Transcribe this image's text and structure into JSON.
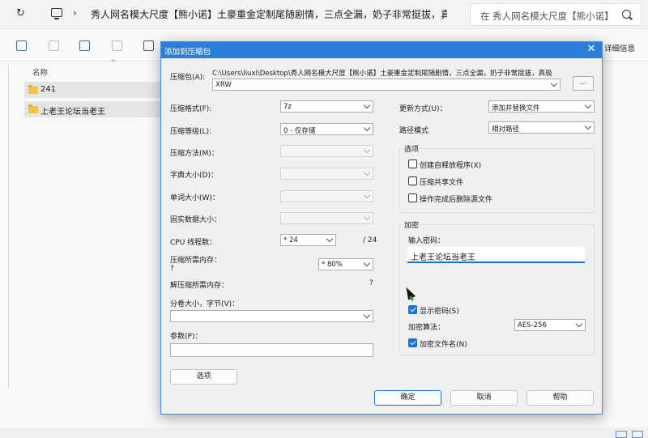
{
  "explorer": {
    "address_text": "秀人网名模大尺度【熊小诺】土豪重金定制尾随剧情，三点全漏，奶子非常挺拔，真极品",
    "search_placeholder": "在 秀人网名模大尺度【熊小诺】",
    "detail_label": "详细信息",
    "column_name": "名称",
    "files": [
      {
        "name": "241",
        "type": "folder-icon"
      },
      {
        "name": "上老王论坛当老王",
        "type": "folder-icon"
      }
    ]
  },
  "dialog": {
    "title": "添加到压缩包",
    "archive_label": "压缩包(A):",
    "archive_path": "C:\\Users\\liuxi\\Desktop\\秀人网名模大尺度【熊小诺】土豪重金定制尾随剧情，三点全漏，奶子非常挺拔，真极",
    "archive_name": "XRW",
    "browse_label": "...",
    "format_label": "压缩格式(F):",
    "format_value": "7z",
    "level_label": "压缩等级(L):",
    "level_value": "0 - 仅存储",
    "method_label": "压缩方法(M)：",
    "dict_label": "字典大小(D)：",
    "word_label": "单词大小(W)：",
    "solid_label": "固实数据大小：",
    "cpu_label": "CPU 线程数：",
    "cpu_value": "* 24",
    "cpu_max": "/ 24",
    "mem_compress_label": "压缩所需内存：",
    "mem_compress_value": "?",
    "mem_percent": "* 80%",
    "mem_decompress_label": "解压缩所需内存：",
    "mem_decompress_value": "?",
    "split_label": "分卷大小，字节(V)：",
    "split_value": "",
    "params_label": "参数(P)：",
    "params_value": "",
    "options_button": "选项",
    "update_label": "更新方式(U)：",
    "update_value": "添加并替换文件",
    "path_mode_label": "路径模式",
    "path_mode_value": "相对路径",
    "options_group": "选项",
    "opt_sfx": "创建自释放程序(X)",
    "opt_shared": "压缩共享文件",
    "opt_delete": "操作完成后删除源文件",
    "encrypt_group": "加密",
    "password_label": "输入密码：",
    "password_value": "上老王论坛当老王",
    "show_password": "显示密码(S)",
    "encrypt_method_label": "加密算法：",
    "encrypt_method_value": "AES-256",
    "encrypt_names": "加密文件名(N)",
    "ok": "确定",
    "cancel": "取消",
    "help": "帮助"
  }
}
